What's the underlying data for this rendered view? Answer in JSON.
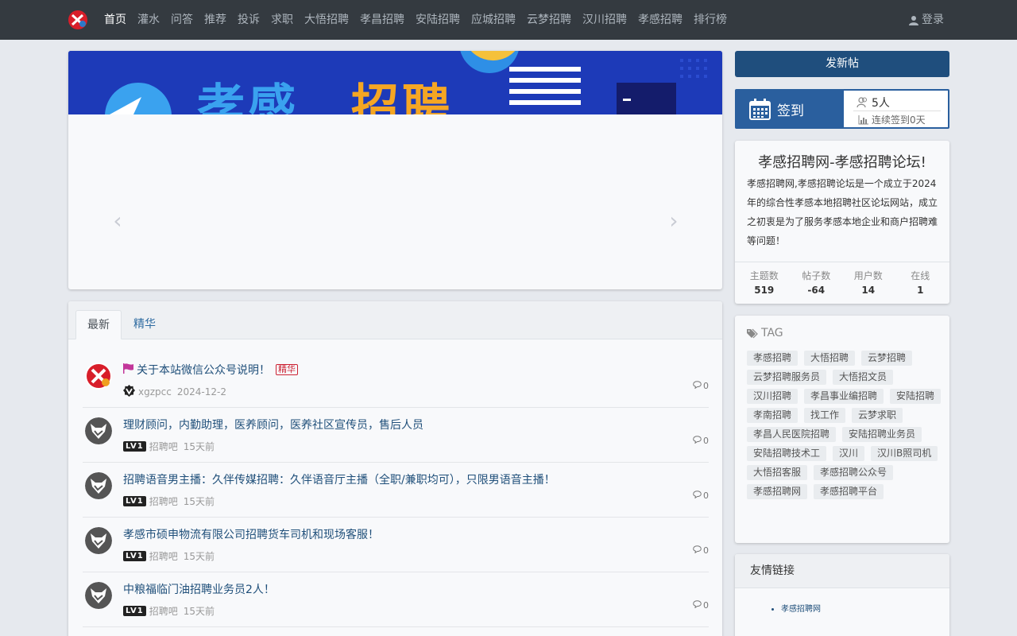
{
  "nav": {
    "items": [
      "首页",
      "灌水",
      "问答",
      "推荐",
      "投诉",
      "求职",
      "大悟招聘",
      "孝昌招聘",
      "安陆招聘",
      "应城招聘",
      "云梦招聘",
      "汉川招聘",
      "孝感招聘",
      "排行榜"
    ],
    "active": "首页",
    "login_label": "登录"
  },
  "banner": {
    "text_part1": "孝感",
    "text_part2": "招聘"
  },
  "tabs": {
    "latest": "最新",
    "featured": "精华"
  },
  "threads": [
    {
      "title": "关于本站微信公众号说明！",
      "badge": "精华",
      "author": "xgzpcc",
      "time": "2024-12-2",
      "replies": "0"
    },
    {
      "title": "理财顾问，内勤助理，医养顾问，医养社区宣传员，售后人员",
      "level": "LV1",
      "author": "招聘吧",
      "time": "15天前",
      "replies": "0"
    },
    {
      "title": "招聘语音男主播：久伴传媒招聘：久伴语音厅主播（全职/兼职均可），只限男语音主播！",
      "level": "LV1",
      "author": "招聘吧",
      "time": "15天前",
      "replies": "0"
    },
    {
      "title": "孝感市硕申物流有限公司招聘货车司机和现场客服！",
      "level": "LV1",
      "author": "招聘吧",
      "time": "15天前",
      "replies": "0"
    },
    {
      "title": "中粮福临门油招聘业务员2人！",
      "level": "LV1",
      "author": "招聘吧",
      "time": "15天前",
      "replies": "0"
    }
  ],
  "sidebar": {
    "post_button": "发新帖",
    "signin": {
      "label": "签到",
      "count": "5人",
      "streak": "连续签到0天"
    },
    "about": {
      "title": "孝感招聘网-孝感招聘论坛!",
      "text": "孝感招聘网,孝感招聘论坛是一个成立于2024年的综合性孝感本地招聘社区论坛网站，成立之初衷是为了服务孝感本地企业和商户招聘难等问题！",
      "stats": [
        {
          "label": "主题数",
          "value": "519"
        },
        {
          "label": "帖子数",
          "value": "-64"
        },
        {
          "label": "用户数",
          "value": "14"
        },
        {
          "label": "在线",
          "value": "1"
        }
      ]
    },
    "tags": {
      "title": "TAG",
      "items": [
        "孝感招聘",
        "大悟招聘",
        "云梦招聘",
        "云梦招聘服务员",
        "大悟招文员",
        "汉川招聘",
        "孝昌事业编招聘",
        "安陆招聘",
        "孝南招聘",
        "找工作",
        "云梦求职",
        "孝昌人民医院招聘",
        "安陆招聘业务员",
        "安陆招聘技术工",
        "汉川",
        "汉川B照司机",
        "大悟招客服",
        "孝感招聘公众号",
        "孝感招聘网",
        "孝感招聘平台"
      ]
    },
    "links": {
      "title": "友情链接",
      "items": [
        "孝感招聘网"
      ]
    }
  },
  "colors": {
    "navbar": "#343a40",
    "primary": "#1f4e7d",
    "signin": "#2a5f9e",
    "link": "#1f4f7a"
  }
}
